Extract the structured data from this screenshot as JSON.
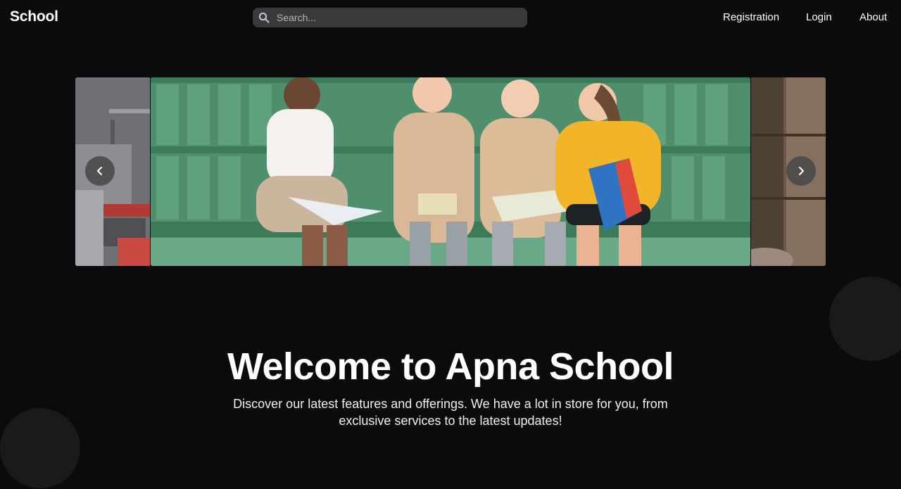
{
  "header": {
    "logo": "School",
    "search": {
      "placeholder": "Search..."
    },
    "nav": [
      {
        "label": "Registration"
      },
      {
        "label": "Login"
      },
      {
        "label": "About"
      }
    ]
  },
  "carousel": {
    "slides": [
      {
        "description": "classroom"
      },
      {
        "description": "four girls reading books on a green bench"
      },
      {
        "description": "wooden room"
      }
    ],
    "prev_icon": "chevron-left-icon",
    "next_icon": "chevron-right-icon"
  },
  "hero": {
    "title": "Welcome to Apna School",
    "subtitle": "Discover our latest features and offerings. We have a lot in store for you, from exclusive services to the latest updates!"
  },
  "colors": {
    "background": "#0b0b0d",
    "search_bg": "#3a3a3c",
    "text": "#ffffff"
  }
}
